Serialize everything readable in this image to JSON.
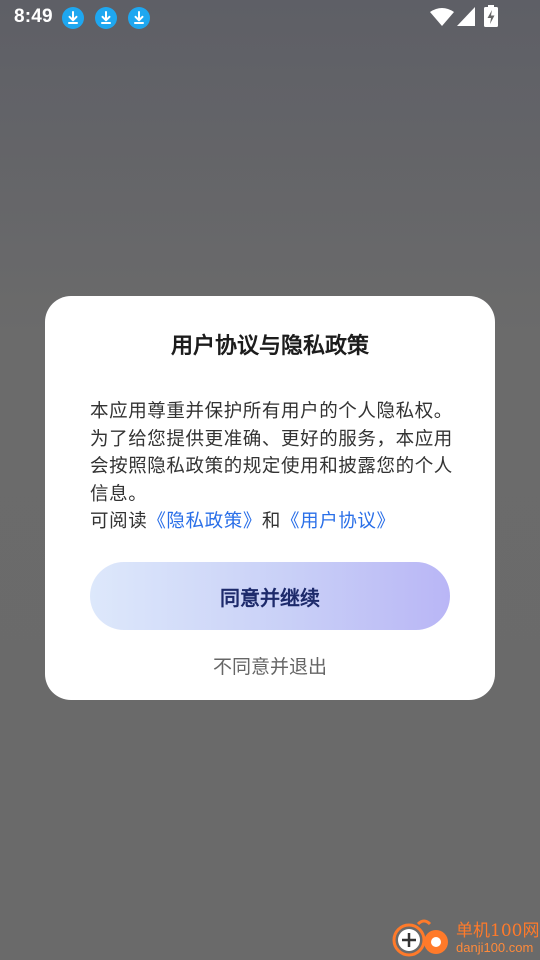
{
  "status_bar": {
    "time": "8:49",
    "notification_icons": [
      "download-icon",
      "download-icon",
      "download-icon"
    ],
    "system_icons": [
      "wifi-icon",
      "signal-icon",
      "battery-charging-icon"
    ]
  },
  "dialog": {
    "title": "用户协议与隐私政策",
    "body_text": "本应用尊重并保护所有用户的个人隐私权。为了给您提供更准确、更好的服务，本应用会按照隐私政策的规定使用和披露您的个人信息。",
    "read_prefix": "可阅读",
    "privacy_link": "《隐私政策》",
    "and_text": "和",
    "user_agreement_link": "《用户协议》",
    "agree_label": "同意并继续",
    "decline_label": "不同意并退出"
  },
  "watermark": {
    "line1": "单机100网",
    "line2": "danji100.com"
  },
  "colors": {
    "link": "#2a6fe8",
    "button_gradient_start": "#dde8fb",
    "button_gradient_end": "#b9b6f6",
    "notification_icon": "#1ea7f0",
    "watermark": "#ff7a2a"
  }
}
